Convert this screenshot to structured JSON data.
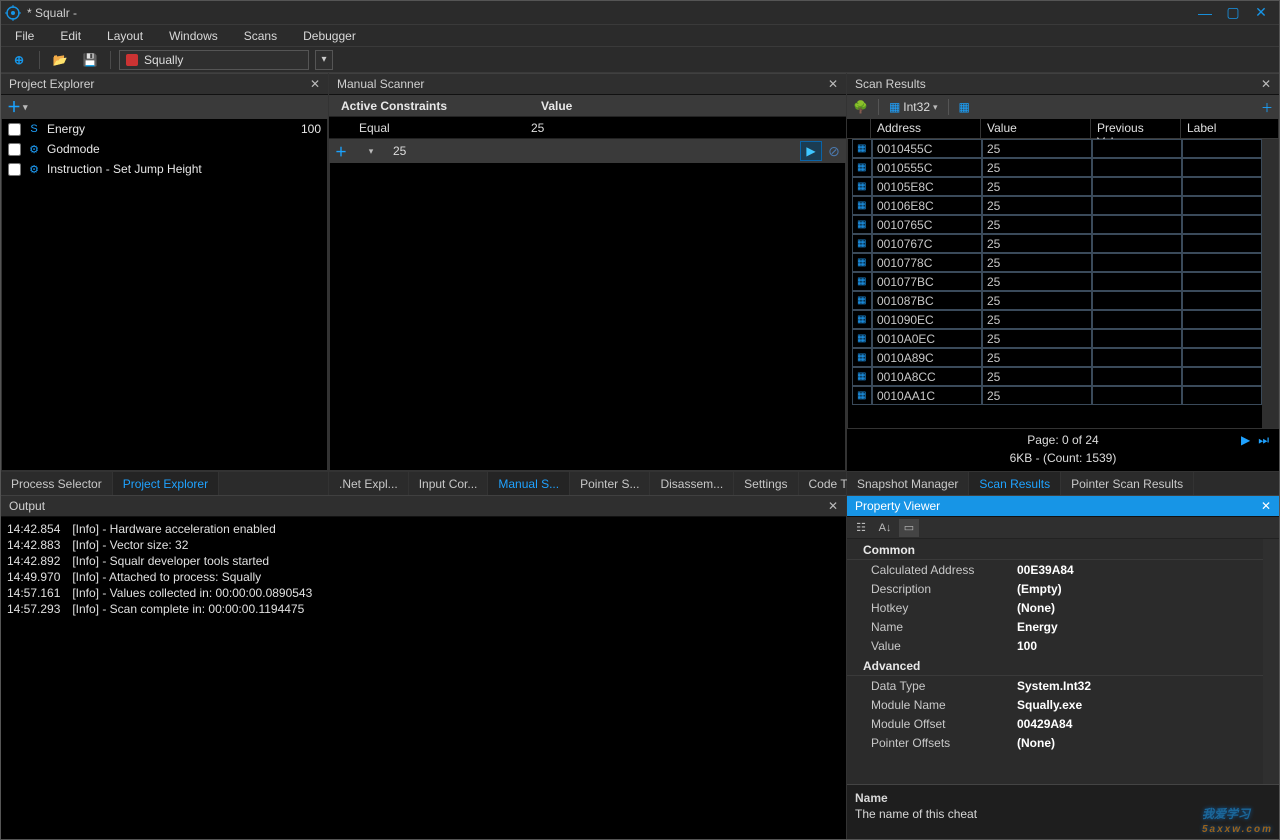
{
  "title": "* Squalr -",
  "menu": [
    "File",
    "Edit",
    "Layout",
    "Windows",
    "Scans",
    "Debugger"
  ],
  "process": {
    "name": "Squally"
  },
  "panels": {
    "project_explorer": "Project Explorer",
    "manual_scanner": "Manual Scanner",
    "scan_results": "Scan Results",
    "output": "Output",
    "property_viewer": "Property Viewer"
  },
  "tabs_left": {
    "items": [
      "Process Selector",
      "Project Explorer"
    ],
    "active": 1
  },
  "tabs_mid": {
    "items": [
      ".Net Expl...",
      "Input Cor...",
      "Manual S...",
      "Pointer S...",
      "Disassem...",
      "Settings",
      "Code Tra..."
    ],
    "active": 2
  },
  "tabs_right": {
    "items": [
      "Snapshot Manager",
      "Scan Results",
      "Pointer Scan Results"
    ],
    "active": 1
  },
  "pe_items": [
    {
      "icon": "S",
      "iconColor": "#1fa2ff",
      "name": "Energy",
      "value": "100"
    },
    {
      "icon": "⚙",
      "iconColor": "#1fa2ff",
      "name": "Godmode",
      "value": ""
    },
    {
      "icon": "⚙",
      "iconColor": "#1fa2ff",
      "name": "Instruction - Set Jump Height",
      "value": ""
    }
  ],
  "constraints": {
    "col_constraint": "Active Constraints",
    "col_value": "Value",
    "rows": [
      {
        "name": "Equal",
        "value": "25"
      }
    ],
    "input_value": "25"
  },
  "scan": {
    "type_label": "Int32",
    "cols": {
      "address": "Address",
      "value": "Value",
      "prev": "Previous Value",
      "label": "Label"
    },
    "rows": [
      {
        "addr": "0010455C",
        "val": "25"
      },
      {
        "addr": "0010555C",
        "val": "25"
      },
      {
        "addr": "00105E8C",
        "val": "25"
      },
      {
        "addr": "00106E8C",
        "val": "25"
      },
      {
        "addr": "0010765C",
        "val": "25"
      },
      {
        "addr": "0010767C",
        "val": "25"
      },
      {
        "addr": "0010778C",
        "val": "25"
      },
      {
        "addr": "001077BC",
        "val": "25"
      },
      {
        "addr": "001087BC",
        "val": "25"
      },
      {
        "addr": "001090EC",
        "val": "25"
      },
      {
        "addr": "0010A0EC",
        "val": "25"
      },
      {
        "addr": "0010A89C",
        "val": "25"
      },
      {
        "addr": "0010A8CC",
        "val": "25"
      },
      {
        "addr": "0010AA1C",
        "val": "25"
      }
    ],
    "pager": "Page: 0 of 24",
    "count": "6KB - (Count: 1539)"
  },
  "output_lines": [
    {
      "ts": "14:42.854",
      "msg": "[Info] - Hardware acceleration enabled"
    },
    {
      "ts": "14:42.883",
      "msg": "[Info] - Vector size: 32"
    },
    {
      "ts": "14:42.892",
      "msg": "[Info] - Squalr developer tools started"
    },
    {
      "ts": "14:49.970",
      "msg": "[Info] - Attached to process: Squally"
    },
    {
      "ts": "14:57.161",
      "msg": "[Info] - Values collected in: 00:00:00.0890543"
    },
    {
      "ts": "14:57.293",
      "msg": "[Info] - Scan complete in: 00:00:00.1194475"
    }
  ],
  "property": {
    "groups": [
      {
        "title": "Common",
        "rows": [
          {
            "k": "Calculated Address",
            "v": "00E39A84"
          },
          {
            "k": "Description",
            "v": "(Empty)"
          },
          {
            "k": "Hotkey",
            "v": "(None)"
          },
          {
            "k": "Name",
            "v": "Energy"
          },
          {
            "k": "Value",
            "v": "100"
          }
        ]
      },
      {
        "title": "Advanced",
        "rows": [
          {
            "k": "Data Type",
            "v": "System.Int32"
          },
          {
            "k": "Module Name",
            "v": "Squally.exe"
          },
          {
            "k": "Module Offset",
            "v": "00429A84"
          },
          {
            "k": "Pointer Offsets",
            "v": "(None)"
          }
        ]
      }
    ],
    "desc_name": "Name",
    "desc_text": "The name of this cheat"
  },
  "watermark": {
    "main": "我爱学习",
    "sub": "5axxw.com"
  }
}
